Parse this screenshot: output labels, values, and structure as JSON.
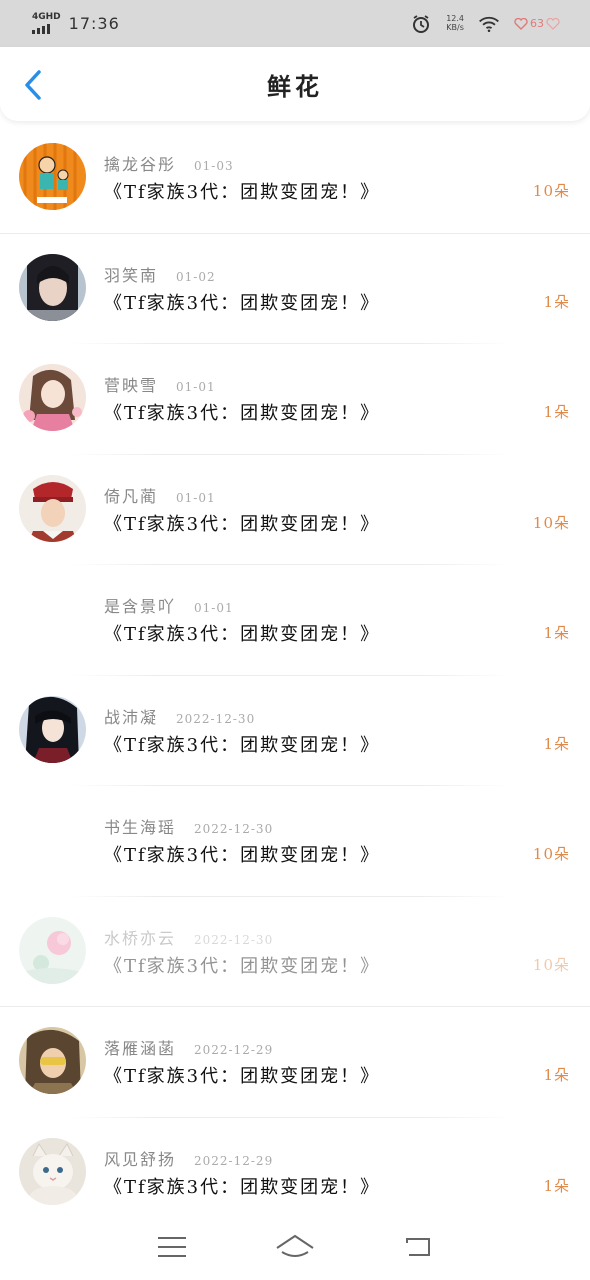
{
  "status_bar": {
    "network": "4GHD",
    "time": "17:36",
    "speed_value": "12.4",
    "speed_unit": "KB/s",
    "battery": "63"
  },
  "header": {
    "title": "鲜花"
  },
  "flowers": [
    {
      "name": "擒龙谷彤",
      "date": "01-03",
      "message": "《Tf家族3代：团欺变团宠！》",
      "count": "10朵",
      "avatar": "cartoon-orange"
    },
    {
      "name": "羽笑南",
      "date": "01-02",
      "message": "《Tf家族3代：团欺变团宠！》",
      "count": "1朵",
      "avatar": "girl-dark"
    },
    {
      "name": "菅映雪",
      "date": "01-01",
      "message": "《Tf家族3代：团欺变团宠！》",
      "count": "1朵",
      "avatar": "anime-girl"
    },
    {
      "name": "倚凡蔺",
      "date": "01-01",
      "message": "《Tf家族3代：团欺变团宠！》",
      "count": "10朵",
      "avatar": "boy-red-cap"
    },
    {
      "name": "是含景吖",
      "date": "01-01",
      "message": "《Tf家族3代：团欺变团宠！》",
      "count": "1朵",
      "avatar": ""
    },
    {
      "name": "战沛凝",
      "date": "2022-12-30",
      "message": "《Tf家族3代：团欺变团宠！》",
      "count": "1朵",
      "avatar": "anime-dark-hair"
    },
    {
      "name": "书生海瑶",
      "date": "2022-12-30",
      "message": "《Tf家族3代：团欺变团宠！》",
      "count": "10朵",
      "avatar": ""
    },
    {
      "name": "水桥亦云",
      "date": "2022-12-30",
      "message": "《Tf家族3代：团欺变团宠！》",
      "count": "10朵",
      "avatar": "pink-flower"
    },
    {
      "name": "落雁涵菡",
      "date": "2022-12-29",
      "message": "《Tf家族3代：团欺变团宠！》",
      "count": "1朵",
      "avatar": "girl-sunglasses"
    },
    {
      "name": "风见舒扬",
      "date": "2022-12-29",
      "message": "《Tf家族3代：团欺变团宠！》",
      "count": "1朵",
      "avatar": "white-cat"
    }
  ],
  "colors": {
    "accent_blue": "#2a8ee8",
    "count_orange": "#e08a4a",
    "status_bar_bg": "#d9d9d9"
  },
  "nav": {
    "icons": [
      "menu-icon",
      "home-icon",
      "back-icon"
    ]
  }
}
